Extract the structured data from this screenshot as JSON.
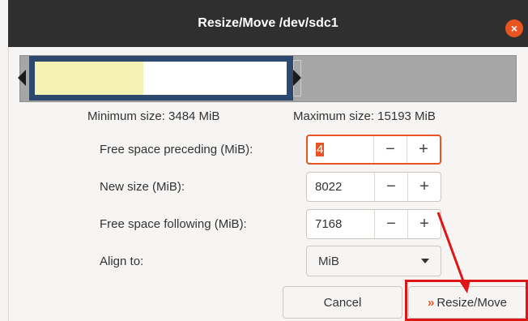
{
  "window": {
    "title": "Resize/Move /dev/sdc1",
    "close_icon": "×"
  },
  "graph": {
    "colors": {
      "outline": "#2d4a6e",
      "used": "#f5f3b3",
      "free": "#ffffff",
      "unallocated": "#a6a6a6"
    },
    "used_fraction": 0.43
  },
  "limits": {
    "minimum": "Minimum size: 3484 MiB",
    "maximum": "Maximum size: 15193 MiB"
  },
  "fields": {
    "preceding": {
      "label": "Free space preceding (MiB):",
      "value": "4"
    },
    "new_size": {
      "label": "New size (MiB):",
      "value": "8022"
    },
    "following": {
      "label": "Free space following (MiB):",
      "value": "7168"
    },
    "align": {
      "label": "Align to:",
      "value": "MiB"
    }
  },
  "stepper": {
    "minus": "−",
    "plus": "+"
  },
  "buttons": {
    "cancel": "Cancel",
    "resize": "Resize/Move",
    "resize_icon": "»"
  },
  "annotation_color": "#e01616"
}
